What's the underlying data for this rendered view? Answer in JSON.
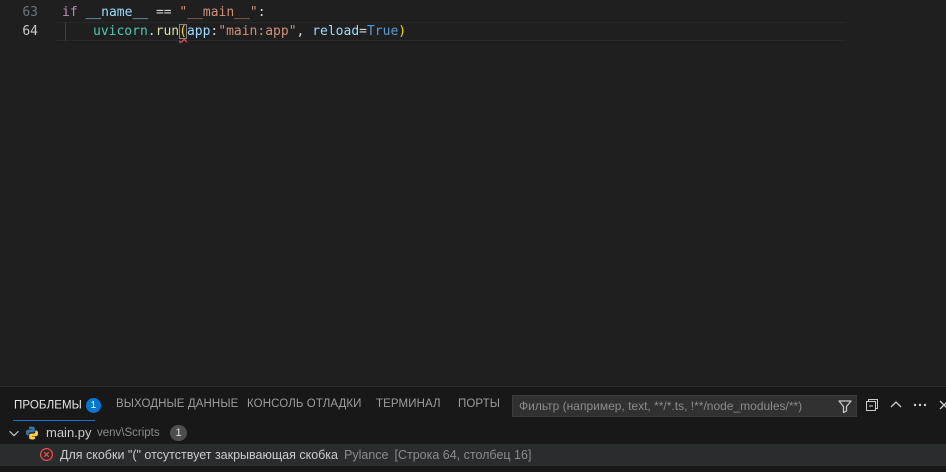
{
  "editor": {
    "lines": [
      {
        "number": "63",
        "tokens": [
          "if",
          "__name__",
          "==",
          "\"__main__\"",
          ":"
        ]
      },
      {
        "number": "64",
        "tokens": [
          "uvicorn",
          ".",
          "run",
          "(",
          "app",
          ":",
          "\"main:app\"",
          ", ",
          "reload",
          "=",
          "True",
          ")"
        ]
      }
    ]
  },
  "panel": {
    "tabs": [
      {
        "label": "ПРОБЛЕМЫ",
        "badge": "1"
      },
      {
        "label": "ВЫХОДНЫЕ ДАННЫЕ"
      },
      {
        "label": "КОНСОЛЬ ОТЛАДКИ"
      },
      {
        "label": "ТЕРМИНАЛ"
      },
      {
        "label": "ПОРТЫ"
      }
    ],
    "filter_placeholder": "Фильтр (например, text, **/*.ts, !**/node_modules/**)",
    "icons": [
      "filter-icon",
      "collapse-all-icon",
      "maximize-panel-icon",
      "close-icon"
    ]
  },
  "problems": {
    "file": {
      "name": "main.py",
      "path": "venv\\Scripts",
      "count": "1"
    },
    "items": [
      {
        "message": "Для скобки \"(\" отсутствует закрывающая скобка",
        "source": "Pylance",
        "location": "[Строка 64, столбец 16]"
      }
    ]
  },
  "colors": {
    "background": "#1f1f1f",
    "accent": "#0078d4",
    "error": "#f14c4c",
    "keyword": "#c586c0",
    "function": "#dcdcaa",
    "string": "#ce9178",
    "variable": "#9cdcfe",
    "constant": "#569cd6"
  }
}
